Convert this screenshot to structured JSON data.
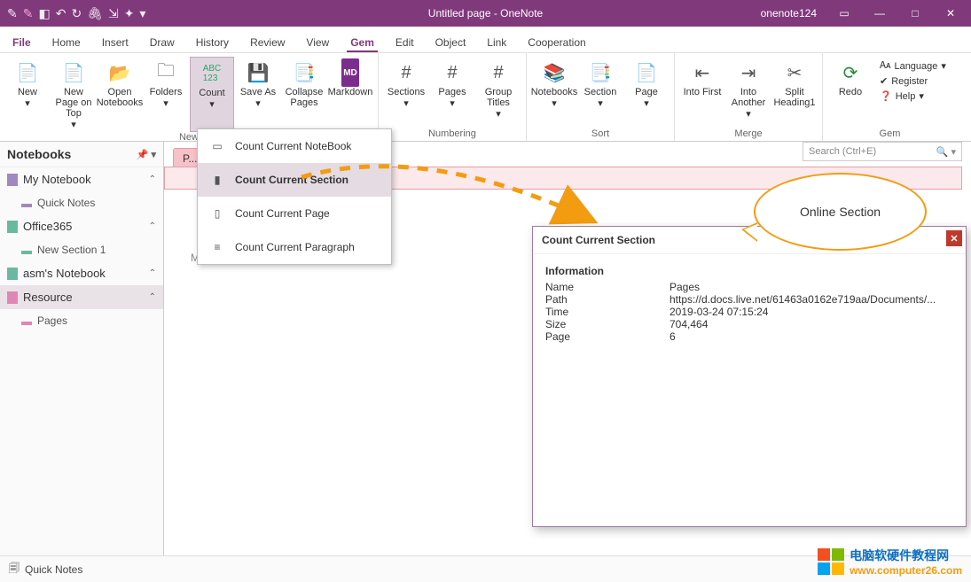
{
  "title_bar": {
    "app_title": "Untitled page  -  OneNote",
    "user": "onenote124"
  },
  "tabs": {
    "file": "File",
    "items": [
      "Home",
      "Insert",
      "Draw",
      "History",
      "Review",
      "View",
      "Gem",
      "Edit",
      "Object",
      "Link",
      "Cooperation"
    ],
    "active": "Gem"
  },
  "ribbon": {
    "group1": {
      "label": "New",
      "new": "New",
      "new_page_top": "New Page on Top",
      "open_nb": "Open Notebooks",
      "folders": "Folders",
      "count": "Count",
      "save_as": "Save As",
      "collapse": "Collapse Pages",
      "markdown": "Markdown"
    },
    "group2": {
      "label": "Numbering",
      "sections": "Sections",
      "pages": "Pages",
      "group_titles": "Group Titles"
    },
    "group3": {
      "label": "Sort",
      "notebooks": "Notebooks",
      "section": "Section",
      "page": "Page"
    },
    "group4": {
      "label": "Merge",
      "into_first": "Into First",
      "into_another": "Into Another",
      "split_h1": "Split Heading1"
    },
    "group5": {
      "label": "Gem",
      "redo": "Redo",
      "language": "Language",
      "register": "Register",
      "help": "Help"
    }
  },
  "dropdown": {
    "items": [
      "Count Current NoteBook",
      "Count Current Section",
      "Count Current Page",
      "Count Current Paragraph"
    ],
    "selected_index": 1
  },
  "notebooks_panel": {
    "header": "Notebooks",
    "items": [
      {
        "label": "My Notebook",
        "color": "#a088c0",
        "expandable": true
      },
      {
        "label": "Quick Notes",
        "indent": true,
        "color": "#a088c0"
      },
      {
        "label": "Office365",
        "color": "#6bb8a0",
        "expandable": true
      },
      {
        "label": "New Section 1",
        "indent": true,
        "color": "#6bb8a0"
      },
      {
        "label": "asm's Notebook",
        "color": "#6bb8a0",
        "expandable": true
      },
      {
        "label": "Resource",
        "color": "#e086b5",
        "expandable": true,
        "selected": true
      },
      {
        "label": "Pages",
        "indent": true,
        "color": "#e086b5"
      }
    ]
  },
  "section_tab": "P...",
  "search": {
    "placeholder": "Search (Ctrl+E)"
  },
  "page_meta": "M",
  "dialog": {
    "title": "Count Current Section",
    "info_label": "Information",
    "rows": [
      {
        "k": "Name",
        "v": "Pages"
      },
      {
        "k": "Path",
        "v": "https://d.docs.live.net/61463a0162e719aa/Documents/..."
      },
      {
        "k": "Time",
        "v": "2019-03-24 07:15:24"
      },
      {
        "k": "Size",
        "v": "704,464"
      },
      {
        "k": "Page",
        "v": "6"
      }
    ]
  },
  "callout": "Online Section",
  "status": {
    "quick_notes": "Quick Notes"
  },
  "watermark": {
    "line1": "电脑软硬件教程网",
    "line2": "www.computer26.com"
  }
}
